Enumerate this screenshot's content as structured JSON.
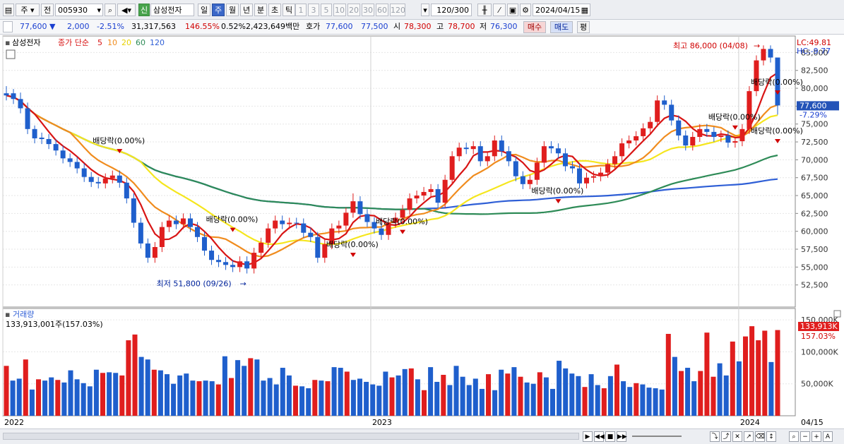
{
  "toolbar": {
    "period_type": "주",
    "market": "전",
    "code": "005930",
    "new_badge": "신",
    "stock_name": "삼성전자",
    "timeframes": [
      "일",
      "주",
      "월",
      "년",
      "분",
      "초",
      "틱"
    ],
    "active_timeframe": "주",
    "minute_presets": [
      "1",
      "3",
      "5",
      "10",
      "20",
      "30",
      "60",
      "120"
    ],
    "view_count": "120",
    "total_count": "/300",
    "date": "2024/04/15"
  },
  "quote": {
    "price": "77,600",
    "change": "2,000",
    "change_pct": "-2.51%",
    "volume": "31,317,563",
    "volume_ratio": "146.55%",
    "turnover": "0.52%",
    "amount": "2,423,649백만",
    "ask_label": "호가",
    "ask1": "77,600",
    "ask2": "77,500",
    "open_label": "시",
    "open": "78,300",
    "high_label": "고",
    "high": "78,700",
    "low_label": "저",
    "low": "76,300",
    "buy_label": "매수",
    "sell_label": "매도",
    "eval_label": "평"
  },
  "legend": {
    "stock": "삼성전자",
    "ma_prefix": "종가 단순",
    "ma_periods": [
      "5",
      "10",
      "20",
      "60",
      "120"
    ]
  },
  "lc_label": "LC:49.81",
  "hc_label": "HC:-9.77",
  "volume_panel": {
    "title": "거래량",
    "value_text": "133,913,001주(157.03%)",
    "current_tag": "133,913K",
    "current_pct": "157.03%"
  },
  "colors": {
    "up": "#e01e1e",
    "down": "#1f5fcc",
    "ma5": "#d81414",
    "ma10": "#f08c1e",
    "ma20": "#f5e61e",
    "ma60": "#2e8b57",
    "ma120": "#2f5fd6"
  },
  "chart_data": {
    "type": "candlestick",
    "x_labels": [
      {
        "label": "2022",
        "index": 0
      },
      {
        "label": "2023",
        "index": 52
      },
      {
        "label": "2024",
        "index": 104
      }
    ],
    "end_date_label": "04/15",
    "price_axis": {
      "min": 50000,
      "max": 86000,
      "ticks": [
        "52,500",
        "55,000",
        "57,500",
        "60,000",
        "62,500",
        "65,000",
        "67,500",
        "70,000",
        "72,500",
        "75,000",
        "77,500",
        "80,000",
        "82,500",
        "85,000"
      ]
    },
    "current_price_tag": "77,600",
    "current_change_tag": "-7.29%",
    "volume_axis": {
      "max": 160000,
      "ticks": [
        "50,000K",
        "100,000K",
        "150,000K"
      ]
    },
    "close": [
      79000,
      78500,
      77200,
      74300,
      73000,
      72900,
      72200,
      71300,
      70200,
      69700,
      68800,
      67600,
      66900,
      66700,
      67400,
      67800,
      66800,
      64600,
      61200,
      58300,
      56300,
      57800,
      60600,
      61500,
      61000,
      61800,
      60600,
      59200,
      57300,
      56000,
      55700,
      55300,
      55000,
      55800,
      54800,
      57000,
      58400,
      60400,
      61500,
      61000,
      61200,
      61100,
      59800,
      59200,
      56300,
      58200,
      60400,
      60800,
      62600,
      64200,
      62400,
      61300,
      60400,
      59500,
      61200,
      61900,
      63000,
      64600,
      65000,
      65500,
      65900,
      64000,
      67200,
      70500,
      71700,
      71500,
      71900,
      69800,
      70500,
      72700,
      71200,
      69800,
      67700,
      66600,
      67200,
      69600,
      71900,
      71600,
      70900,
      69100,
      68800,
      66700,
      67500,
      67700,
      68200,
      69400,
      70500,
      72300,
      72700,
      73300,
      74400,
      75300,
      78300,
      77700,
      75500,
      73400,
      72000,
      73200,
      74300,
      73900,
      73200,
      73400,
      72400,
      72600,
      74300,
      79600,
      83900,
      85500,
      84300,
      77600
    ],
    "open": [
      79300,
      79300,
      78500,
      77200,
      74300,
      73100,
      72900,
      72200,
      71300,
      70200,
      69700,
      68800,
      67600,
      66900,
      66700,
      67400,
      67800,
      66800,
      64600,
      61200,
      58300,
      56300,
      57800,
      60600,
      61500,
      61000,
      61800,
      60600,
      59200,
      57300,
      56000,
      55700,
      55300,
      55000,
      55800,
      54800,
      57000,
      58400,
      60400,
      61500,
      61000,
      61200,
      61100,
      59800,
      59200,
      56300,
      58200,
      60400,
      60800,
      62600,
      64200,
      62400,
      61300,
      60400,
      59500,
      61200,
      61900,
      63000,
      64600,
      65000,
      65500,
      65900,
      64000,
      67200,
      70500,
      71700,
      71500,
      71900,
      69800,
      70500,
      72700,
      71200,
      69800,
      67700,
      66600,
      67200,
      69600,
      71900,
      71600,
      70900,
      69100,
      68800,
      66700,
      67500,
      67700,
      68200,
      69400,
      70500,
      72300,
      72700,
      73300,
      74400,
      75300,
      78300,
      77700,
      75500,
      73400,
      72000,
      73200,
      74300,
      73900,
      73200,
      73400,
      72400,
      72600,
      74300,
      79600,
      83900,
      85500,
      84300
    ],
    "high": [
      80300,
      79900,
      79400,
      78000,
      74800,
      73800,
      73600,
      72900,
      72000,
      70900,
      70400,
      69500,
      68300,
      67600,
      68100,
      68500,
      68500,
      67500,
      65300,
      61900,
      59000,
      58500,
      61300,
      62200,
      62200,
      62500,
      62500,
      61300,
      59900,
      58000,
      56700,
      56400,
      56000,
      56500,
      56500,
      57700,
      59100,
      61100,
      62200,
      62200,
      61900,
      61900,
      61800,
      60500,
      59900,
      58900,
      61100,
      61500,
      63300,
      65300,
      64900,
      63100,
      62000,
      61100,
      61900,
      62600,
      63700,
      65300,
      65700,
      66200,
      66600,
      66600,
      67900,
      71200,
      72400,
      72400,
      72600,
      72600,
      71200,
      73400,
      73400,
      71900,
      70500,
      68400,
      67900,
      70300,
      72600,
      72600,
      72300,
      71600,
      69800,
      69500,
      68200,
      68400,
      68900,
      70100,
      71200,
      73000,
      73400,
      74000,
      75100,
      76000,
      79000,
      79000,
      78400,
      76200,
      74100,
      73900,
      75000,
      75000,
      74600,
      74100,
      74100,
      73100,
      75000,
      80300,
      84600,
      86000,
      86000,
      78700
    ],
    "low": [
      78300,
      77800,
      76500,
      73600,
      72300,
      72200,
      71500,
      70600,
      69500,
      69000,
      68100,
      66900,
      66200,
      66000,
      66000,
      66700,
      66100,
      63900,
      60500,
      57600,
      55600,
      55600,
      57100,
      59900,
      60300,
      60300,
      59900,
      58500,
      56600,
      55300,
      55000,
      54600,
      54300,
      54300,
      54100,
      54100,
      56300,
      57700,
      59700,
      60300,
      60300,
      60400,
      59100,
      58500,
      55600,
      55600,
      57500,
      59700,
      60100,
      61900,
      61700,
      60600,
      59700,
      58800,
      58800,
      60500,
      61200,
      62300,
      63900,
      64300,
      64800,
      63300,
      63300,
      66500,
      69800,
      70800,
      70800,
      69100,
      69100,
      69800,
      70500,
      69100,
      67000,
      65900,
      65900,
      66500,
      68900,
      70900,
      70200,
      68400,
      68100,
      66000,
      66000,
      66800,
      67000,
      67500,
      68700,
      69800,
      71600,
      72000,
      72600,
      73700,
      74600,
      77000,
      74800,
      72700,
      71300,
      71300,
      72500,
      73200,
      72500,
      72500,
      71700,
      71700,
      71900,
      73600,
      78900,
      83200,
      83600,
      76300
    ],
    "volume": [
      78000,
      55000,
      58000,
      88000,
      41000,
      57000,
      55000,
      60000,
      56000,
      52000,
      71000,
      57000,
      51000,
      46000,
      72000,
      67000,
      68000,
      67000,
      63000,
      118000,
      127000,
      92000,
      88000,
      72000,
      71000,
      65000,
      50000,
      63000,
      66000,
      55000,
      54000,
      55000,
      54000,
      49000,
      93000,
      59000,
      87000,
      78000,
      90000,
      88000,
      55000,
      59000,
      49000,
      75000,
      63000,
      47000,
      46000,
      43000,
      56000,
      55000,
      54000,
      76000,
      75000,
      69000,
      56000,
      58000,
      53000,
      49000,
      47000,
      69000,
      60000,
      63000,
      73000,
      74000,
      57000,
      40000,
      76000,
      53000,
      64000,
      48000,
      78000,
      61000,
      48000,
      58000,
      42000,
      65000,
      40000,
      72000,
      66000,
      76000,
      61000,
      52000,
      50000,
      68000,
      60000,
      42000,
      86000,
      74000,
      66000,
      62000,
      45000,
      65000,
      48000,
      43000,
      62000,
      80000,
      54000,
      45000,
      51000,
      49000,
      44000,
      43000,
      41000,
      128000,
      92000,
      70000,
      75000,
      54000,
      70000,
      130000,
      61000,
      82000,
      63000,
      116000,
      85000,
      124000,
      140000,
      118000,
      133000,
      84000,
      134000
    ],
    "ma5": [],
    "ma10": [],
    "ma20": [],
    "ma60": [],
    "ma120": [],
    "annotations": [
      {
        "text": "배당락(0.00%)",
        "index": 16,
        "price": 71500
      },
      {
        "text": "배당락(0.00%)",
        "index": 32,
        "price": 60500
      },
      {
        "text": "배당락(0.00%)",
        "index": 49,
        "price": 57000
      },
      {
        "text": "배당락(0.00%)",
        "index": 56,
        "price": 60200
      },
      {
        "text": "배당락(0.00%)",
        "index": 78,
        "price": 64500
      },
      {
        "text": "배당락(0.00%)",
        "index": 103,
        "price": 74800
      },
      {
        "text": "배당락(0.00%)",
        "index": 115,
        "price": 72900
      },
      {
        "text": "배당락(0.00%)",
        "index": 135,
        "price": 79700
      }
    ],
    "max_label": "최고 86,000 (04/08)",
    "min_label": "최저 51,800 (09/26)"
  }
}
